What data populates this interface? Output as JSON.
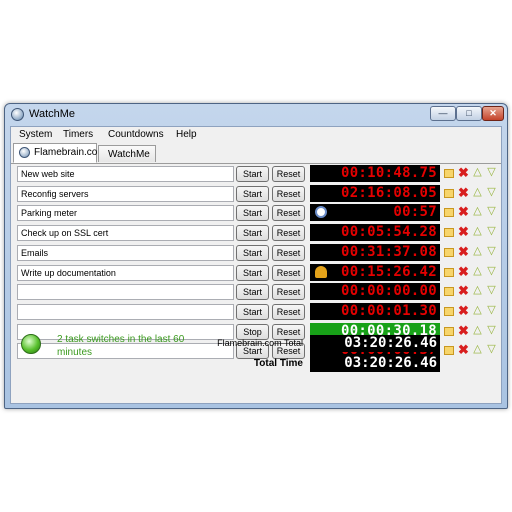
{
  "window": {
    "title": "WatchMe",
    "minimize_label": "—",
    "maximize_label": "□",
    "close_label": "✕"
  },
  "menu": [
    "System",
    "Timers",
    "Countdowns",
    "Help"
  ],
  "tabs": [
    {
      "label": "Flamebrain.com",
      "active": true
    },
    {
      "label": "WatchMe",
      "active": false
    }
  ],
  "buttons": {
    "start": "Start",
    "stop": "Stop",
    "reset": "Reset"
  },
  "tasks": [
    {
      "name": "New web site",
      "time": "00:10:48.75",
      "action": "Start"
    },
    {
      "name": "Reconfig servers",
      "time": "02:16:08.05",
      "action": "Start"
    },
    {
      "name": "Parking meter",
      "time": "00:57",
      "action": "Start",
      "icon": "alarm-clock-icon"
    },
    {
      "name": "Check up on SSL cert",
      "time": "00:05:54.28",
      "action": "Start"
    },
    {
      "name": "Emails",
      "time": "00:31:37.08",
      "action": "Start"
    },
    {
      "name": "Write up documentation",
      "time": "00:15:26.42",
      "action": "Start",
      "icon": "bell-icon"
    },
    {
      "name": "",
      "time": "00:00:00.00",
      "action": "Start"
    },
    {
      "name": "",
      "time": "00:00:01.30",
      "action": "Start"
    },
    {
      "name": "",
      "time": "00:00:30.18",
      "action": "Stop",
      "running": true
    },
    {
      "name": "",
      "time": "00:00:00.37",
      "action": "Start"
    }
  ],
  "status": {
    "text": "2 task switches in the last 60 minutes"
  },
  "totals": {
    "tab_label": "Flamebrain.com Total",
    "tab_time": "03:20:26.46",
    "total_label": "Total Time",
    "total_time": "03:20:26.46"
  },
  "colors": {
    "clock_digits": "#e40000",
    "running_clock_bg": "#18a118",
    "status_text": "#3a9a1e"
  }
}
